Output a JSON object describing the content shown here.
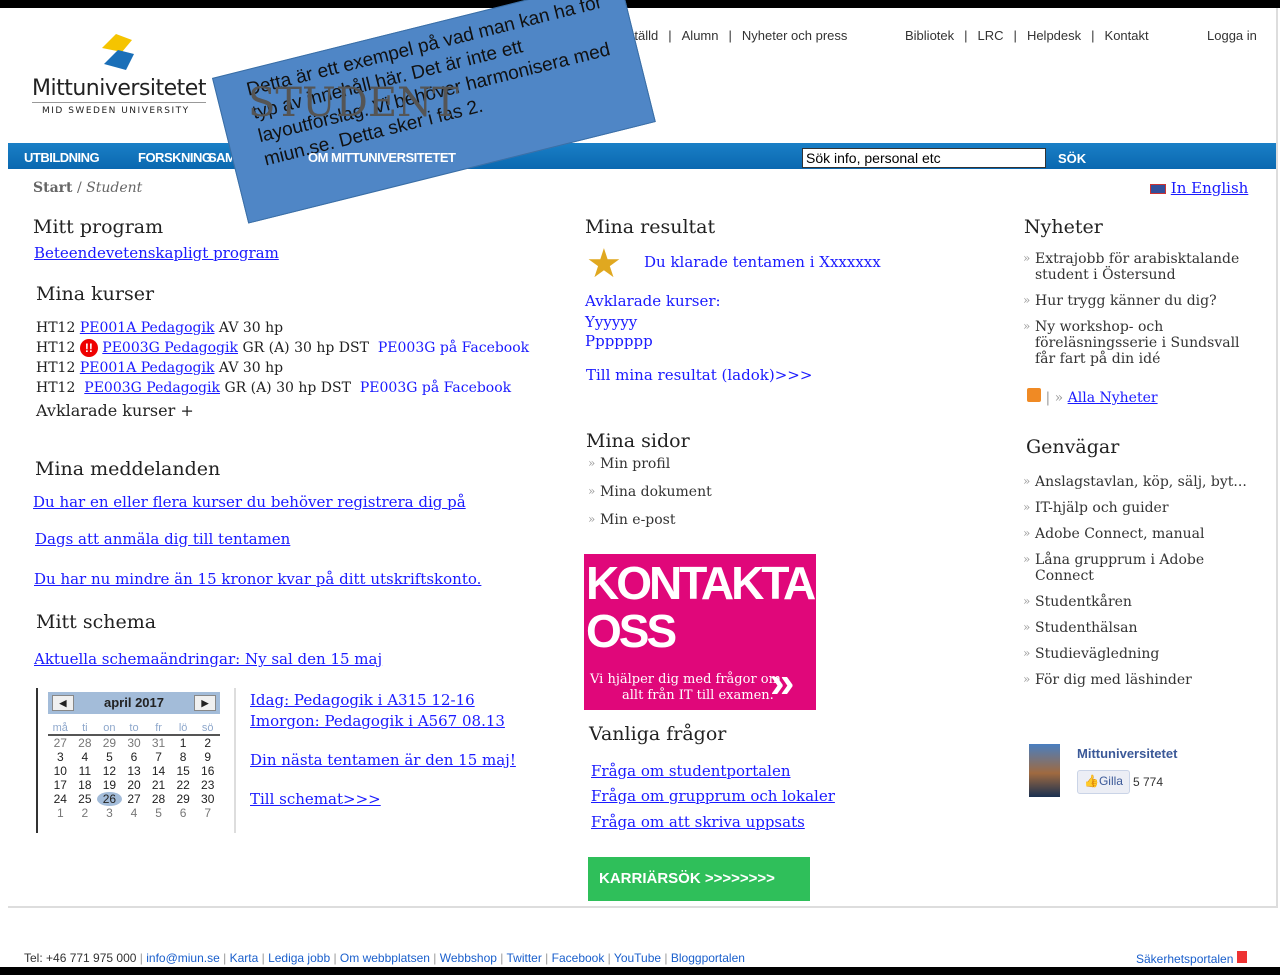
{
  "header": {
    "logo_name": "Mittuniversitetet",
    "logo_sub": "MID SWEDEN UNIVERSITY",
    "section_title": "STUDENT",
    "top_links_left": [
      "Anställd",
      "Alumn",
      "Nyheter och press"
    ],
    "top_links_right": [
      "Bibliotek",
      "LRC",
      "Helpdesk",
      "Kontakt"
    ],
    "login": "Logga in"
  },
  "nav": {
    "items": [
      "UTBILDNING",
      "FORSKNING",
      "SAMVERKAN",
      "OM MITTUNIVERSITETET"
    ],
    "search_placeholder": "Sök info, personal etc",
    "search_button": "SÖK",
    "color": "#0a6fb8"
  },
  "breadcrumb": {
    "start": "Start",
    "current": "Student"
  },
  "language": "In English",
  "overlay_note": "Detta är ett exempel på vad man kan ha för typ av innehåll här. Det är inte ett layoutförslag. Vi  behöver harmonisera med miun.se. Detta sker i fas 2.",
  "program": {
    "title": "Mitt program",
    "link": "Beteendevetenskapligt program"
  },
  "courses": {
    "title": "Mina kurser",
    "rows": [
      {
        "term": "HT12",
        "course": "PE001A Pedagogik",
        "info": "AV 30 hp",
        "warning": false,
        "fb": ""
      },
      {
        "term": "HT12",
        "course": "PE003G Pedagogik",
        "info": "GR (A)  30 hp DST",
        "warning": true,
        "fb": "PE003G på Facebook"
      },
      {
        "term": "HT12",
        "course": "PE001A Pedagogik",
        "info": "AV 30 hp",
        "warning": false,
        "fb": ""
      },
      {
        "term": "HT12",
        "course": "PE003G Pedagogik",
        "info": "GR (A)  30 hp DST",
        "warning": false,
        "fb": "PE003G på Facebook"
      }
    ],
    "completed": "Avklarade kurser +"
  },
  "messages": {
    "title": "Mina meddelanden",
    "items": [
      "Du har en eller flera kurser du behöver registrera dig på",
      "Dags att anmäla dig till tentamen",
      "Du har nu mindre än 15 kronor kvar på ditt utskriftskonto."
    ]
  },
  "schedule": {
    "title": "Mitt schema",
    "changes": "Aktuella schemaändringar: Ny sal den 15 maj",
    "today": "Idag: Pedagogik i A315 12-16",
    "tomorrow": "Imorgon: Pedagogik i A567 08.13",
    "next_exam": "Din nästa tentamen är den 15 maj!",
    "to_schedule": "Till schemat>>>"
  },
  "calendar": {
    "month": "april 2017",
    "days": [
      "må",
      "ti",
      "on",
      "to",
      "fr",
      "lö",
      "sö"
    ],
    "selected": 26,
    "weeks": [
      [
        "27",
        "28",
        "29",
        "30",
        "31",
        "1",
        "2"
      ],
      [
        "3",
        "4",
        "5",
        "6",
        "7",
        "8",
        "9"
      ],
      [
        "10",
        "11",
        "12",
        "13",
        "14",
        "15",
        "16"
      ],
      [
        "17",
        "18",
        "19",
        "20",
        "21",
        "22",
        "23"
      ],
      [
        "24",
        "25",
        "26",
        "27",
        "28",
        "29",
        "30"
      ],
      [
        "1",
        "2",
        "3",
        "4",
        "5",
        "6",
        "7"
      ]
    ]
  },
  "results": {
    "title": "Mina resultat",
    "passed": "Du klarade tentamen i Xxxxxxx",
    "completed_label": "Avklarade kurser:",
    "completed": [
      "Yyyyyy",
      "Ppppppp"
    ],
    "ladok": "Till mina resultat (ladok)>>>"
  },
  "my_pages": {
    "title": "Mina sidor",
    "items": [
      "Min profil",
      "Mina dokument",
      "Min e-post"
    ]
  },
  "contact_banner": {
    "title1": "KONTAKTA",
    "title2": "OSS",
    "text1": "Vi hjälper dig med frågor om",
    "text2": "allt från IT till examen.",
    "color": "#e0077a"
  },
  "faq": {
    "title": "Vanliga frågor",
    "items": [
      "Fråga om studentportalen",
      "Fråga om grupprum och lokaler",
      "Fråga om att skriva uppsats"
    ]
  },
  "career": {
    "label": "KARRIÄRSÖK  >>>>>>>>",
    "color": "#2fbf5a"
  },
  "news": {
    "title": "Nyheter",
    "items": [
      "Extrajobb för arabisktalande student i Östersund",
      "Hur trygg känner du dig?",
      "Ny workshop- och föreläsningsserie i Sundsvall får fart på din idé"
    ],
    "all": "Alla Nyheter"
  },
  "shortcuts": {
    "title": "Genvägar",
    "items": [
      "Anslagstavlan, köp, sälj, byt...",
      "IT-hjälp och guider",
      "Adobe Connect, manual",
      "Låna grupprum i Adobe Connect",
      "Studentkåren",
      "Studenthälsan",
      "Studievägledning",
      "För dig med läshinder"
    ]
  },
  "facebook": {
    "name": "Mittuniversitetet",
    "like": "Gilla",
    "count": "5 774"
  },
  "footer": {
    "tel": "Tel: +46 771 975  000",
    "links": [
      "info@miun.se",
      "Karta",
      "Lediga jobb",
      "Om webbplatsen",
      "Webbshop",
      "Twitter",
      "Facebook",
      "YouTube",
      "Bloggportalen"
    ],
    "security": "Säkerhetsportalen"
  }
}
